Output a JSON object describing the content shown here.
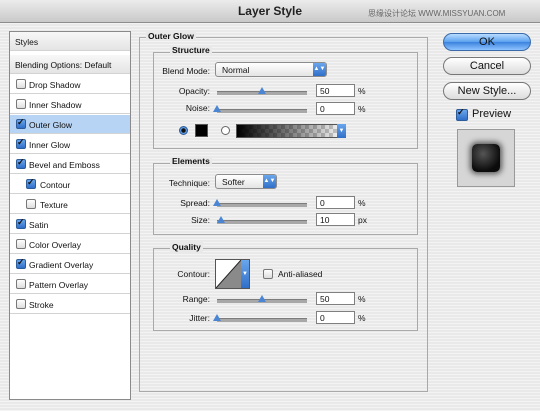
{
  "window": {
    "title": "Layer Style",
    "watermark": "思缘设计论坛 WWW.MISSYUAN.COM"
  },
  "sidebar": {
    "items": [
      {
        "label": "Styles",
        "header": true
      },
      {
        "label": "Blending Options: Default",
        "header": true
      },
      {
        "label": "Drop Shadow",
        "checked": false
      },
      {
        "label": "Inner Shadow",
        "checked": false
      },
      {
        "label": "Outer Glow",
        "checked": true,
        "selected": true
      },
      {
        "label": "Inner Glow",
        "checked": true
      },
      {
        "label": "Bevel and Emboss",
        "checked": true
      },
      {
        "label": "Contour",
        "checked": true,
        "indent": true
      },
      {
        "label": "Texture",
        "checked": false,
        "indent": true
      },
      {
        "label": "Satin",
        "checked": true
      },
      {
        "label": "Color Overlay",
        "checked": false
      },
      {
        "label": "Gradient Overlay",
        "checked": true
      },
      {
        "label": "Pattern Overlay",
        "checked": false
      },
      {
        "label": "Stroke",
        "checked": false
      }
    ]
  },
  "main": {
    "title": "Outer Glow",
    "structure": {
      "title": "Structure",
      "blend_mode_label": "Blend Mode:",
      "blend_mode_value": "Normal",
      "opacity_label": "Opacity:",
      "opacity_value": "50",
      "opacity_fraction": 0.5,
      "noise_label": "Noise:",
      "noise_value": "0",
      "noise_fraction": 0,
      "glow_color": "#000000",
      "mode": "color"
    },
    "elements": {
      "title": "Elements",
      "technique_label": "Technique:",
      "technique_value": "Softer",
      "spread_label": "Spread:",
      "spread_value": "0",
      "spread_fraction": 0,
      "size_label": "Size:",
      "size_value": "10",
      "size_unit": "px",
      "size_fraction": 0.04
    },
    "quality": {
      "title": "Quality",
      "contour_label": "Contour:",
      "antialiased_label": "Anti-aliased",
      "antialiased": false,
      "range_label": "Range:",
      "range_value": "50",
      "range_fraction": 0.5,
      "jitter_label": "Jitter:",
      "jitter_value": "0",
      "jitter_fraction": 0
    },
    "percent": "%"
  },
  "buttons": {
    "ok": "OK",
    "cancel": "Cancel",
    "new_style": "New Style...",
    "preview": "Preview",
    "preview_checked": true
  },
  "colors": {
    "accent": "#3b82de",
    "selection": "#b8d4f4"
  }
}
